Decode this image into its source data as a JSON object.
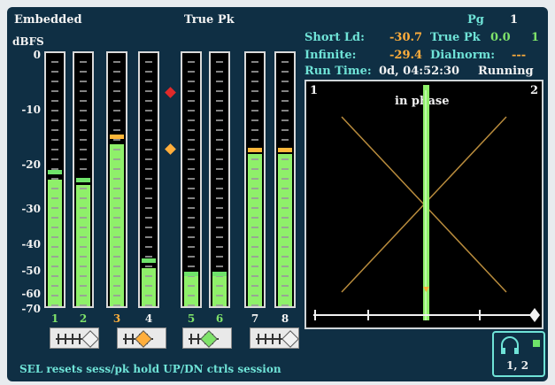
{
  "header": {
    "source_label": "Embedded",
    "mode_label": "True Pk",
    "units_label": "dBFS",
    "pg_label": "Pg",
    "pg_value": "1"
  },
  "readouts": {
    "short_ld_label": "Short Ld:",
    "short_ld_value": "-30.7",
    "true_pk_label": "True Pk",
    "true_pk_value": "0.0",
    "true_pk_channel": "1",
    "infinite_label": "Infinite:",
    "infinite_value": "-29.4",
    "dialnorm_label": "Dialnorm:",
    "dialnorm_value": "---",
    "run_time_label": "Run Time:",
    "run_time_value": "0d, 04:52:30",
    "run_state": "Running"
  },
  "scale": [
    "0",
    "-10",
    "-20",
    "-30",
    "-40",
    "-50",
    "-60",
    "-70"
  ],
  "channels": [
    {
      "label": "1",
      "label_color": "#7fe36a",
      "level": 0.5,
      "peak": 0.52,
      "peak_color": "#6fe36a"
    },
    {
      "label": "2",
      "label_color": "#7fe36a",
      "level": 0.48,
      "peak": 0.49,
      "peak_color": "#6fe36a"
    },
    {
      "label": "3",
      "label_color": "#ffae3b",
      "level": 0.64,
      "peak": 0.66,
      "peak_color": "#ffb83a"
    },
    {
      "label": "4",
      "label_color": "#f2f2f2",
      "level": 0.15,
      "peak": 0.17,
      "peak_color": "#6fe36a"
    },
    {
      "label": "5",
      "label_color": "#7fe36a",
      "level": 0.12,
      "peak": 0.12,
      "peak_color": "#6fe36a"
    },
    {
      "label": "6",
      "label_color": "#7fe36a",
      "level": 0.12,
      "peak": 0.12,
      "peak_color": "#6fe36a"
    },
    {
      "label": "7",
      "label_color": "#f2f2f2",
      "level": 0.6,
      "peak": 0.61,
      "peak_color": "#ffb83a"
    },
    {
      "label": "8",
      "label_color": "#f2f2f2",
      "level": 0.6,
      "peak": 0.61,
      "peak_color": "#ffb83a"
    }
  ],
  "pair_controls": [
    {
      "diamond_color": "#f2f2f2"
    },
    {
      "diamond_color": "#ffae3b"
    },
    {
      "diamond_color": "#7fe36a"
    },
    {
      "diamond_color": "#f2f2f2"
    }
  ],
  "lissajous": {
    "left_channel": "1",
    "right_channel": "2",
    "phase_text": "in phase"
  },
  "footer": {
    "status_text": "SEL resets sess/pk hold  UP/DN ctrls session",
    "headphone_pair": "1, 2"
  },
  "colors": {
    "meter_green": "#8ff06a",
    "peak_red": "#e02a2a",
    "peak_orange": "#ffae3b",
    "cyan_text": "#6fe3d7"
  }
}
